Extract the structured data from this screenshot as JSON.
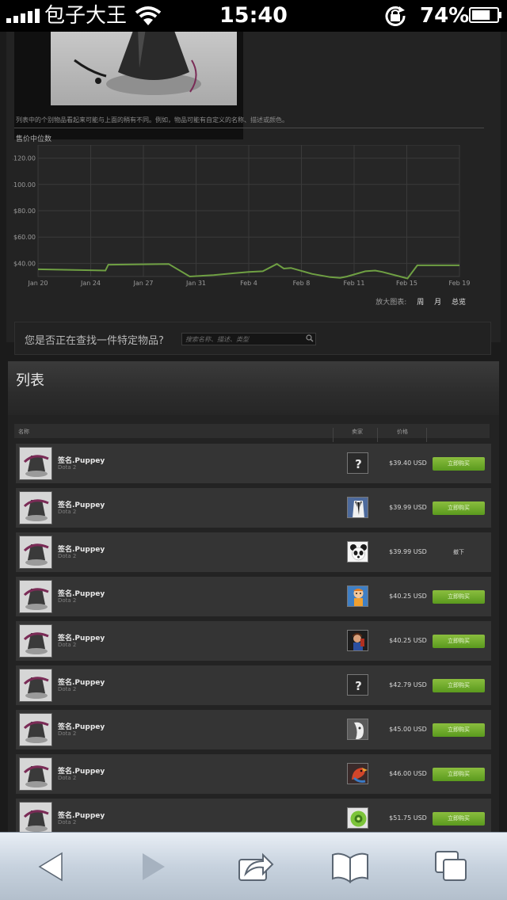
{
  "status_bar": {
    "carrier": "包子大王",
    "time": "15:40",
    "battery": "74%",
    "battery_level": 0.74
  },
  "preview": {
    "disclaimer": "列表中的个别物品看起来可能与上面的稍有不同。例如，物品可能有自定义的名称、描述或颜色。",
    "median_label": "售价中位数"
  },
  "chart_data": {
    "type": "line",
    "title": "",
    "xlabel": "",
    "ylabel": "",
    "x_ticks": [
      "Jan 20",
      "Jan 24",
      "Jan 27",
      "Jan 31",
      "Feb 4",
      "Feb 8",
      "Feb 11",
      "Feb 15",
      "Feb 19"
    ],
    "y_ticks": [
      "$40.00",
      "$60.00",
      "$80.00",
      "$100.00",
      "$120.00"
    ],
    "ylim": [
      30,
      130
    ],
    "xlim": [
      0,
      30
    ],
    "grid": true,
    "line_color": "#6fa043",
    "series": [
      {
        "values": [
          [
            0,
            35.5
          ],
          [
            4.8,
            34.5
          ],
          [
            5,
            39
          ],
          [
            9.3,
            39.5
          ],
          [
            10.8,
            30
          ],
          [
            12.5,
            31
          ],
          [
            14,
            32.5
          ],
          [
            15,
            33.5
          ],
          [
            16,
            34
          ],
          [
            17,
            39.5
          ],
          [
            17.5,
            36
          ],
          [
            18,
            36.5
          ],
          [
            19.5,
            32
          ],
          [
            20.8,
            29.5
          ],
          [
            21.5,
            29
          ],
          [
            22,
            30
          ],
          [
            23.3,
            34
          ],
          [
            24,
            34.5
          ],
          [
            24.5,
            33.5
          ],
          [
            26.3,
            28.5
          ],
          [
            27,
            38.5
          ],
          [
            30,
            38.5
          ]
        ]
      }
    ]
  },
  "zoom": {
    "label": "放大图表:",
    "week": "周",
    "month": "月",
    "all": "总览"
  },
  "search": {
    "prompt": "您是否正在查找一件特定物品?",
    "placeholder": "搜索名称、描述、类型"
  },
  "listings": {
    "title": "列表",
    "columns": {
      "name": "名称",
      "seller": "卖家",
      "price": "价格"
    },
    "rows": [
      {
        "name": "签名.Puppey",
        "game": "Dota 2",
        "seller_icon": "question-mark-avatar",
        "price": "$39.40 USD",
        "action": "立即购买",
        "action_type": "buy"
      },
      {
        "name": "签名.Puppey",
        "game": "Dota 2",
        "seller_icon": "suit-avatar",
        "price": "$39.99 USD",
        "action": "立即购买",
        "action_type": "buy"
      },
      {
        "name": "签名.Puppey",
        "game": "Dota 2",
        "seller_icon": "panda-avatar",
        "price": "$39.99 USD",
        "action": "撤下",
        "action_type": "remove"
      },
      {
        "name": "签名.Puppey",
        "game": "Dota 2",
        "seller_icon": "cartoon-character-avatar",
        "price": "$40.25 USD",
        "action": "立即购买",
        "action_type": "buy"
      },
      {
        "name": "签名.Puppey",
        "game": "Dota 2",
        "seller_icon": "character-avatar",
        "price": "$40.25 USD",
        "action": "立即购买",
        "action_type": "buy"
      },
      {
        "name": "签名.Puppey",
        "game": "Dota 2",
        "seller_icon": "question-mark-avatar",
        "price": "$42.79 USD",
        "action": "立即购买",
        "action_type": "buy"
      },
      {
        "name": "签名.Puppey",
        "game": "Dota 2",
        "seller_icon": "white-face-avatar",
        "price": "$45.00 USD",
        "action": "立即购买",
        "action_type": "buy"
      },
      {
        "name": "签名.Puppey",
        "game": "Dota 2",
        "seller_icon": "red-bird-avatar",
        "price": "$46.00 USD",
        "action": "立即购买",
        "action_type": "buy"
      },
      {
        "name": "签名.Puppey",
        "game": "Dota 2",
        "seller_icon": "green-orb-avatar",
        "price": "$51.75 USD",
        "action": "立即购买",
        "action_type": "buy"
      }
    ]
  },
  "toolbar": {
    "icons": [
      "back-icon",
      "forward-icon",
      "share-icon",
      "bookmarks-icon",
      "tabs-icon"
    ]
  }
}
